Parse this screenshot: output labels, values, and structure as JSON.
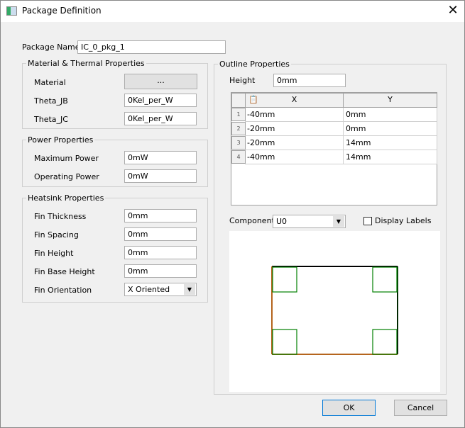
{
  "window": {
    "title": "Package Definition",
    "close_label": "✕"
  },
  "package_name": {
    "label": "Package Name",
    "value": "IC_0_pkg_1"
  },
  "material_group": {
    "title": "Material & Thermal Properties",
    "material_label": "Material",
    "material_button": "...",
    "theta_jb_label": "Theta_JB",
    "theta_jb": "0Kel_per_W",
    "theta_jc_label": "Theta_JC",
    "theta_jc": "0Kel_per_W"
  },
  "power_group": {
    "title": "Power Properties",
    "max_label": "Maximum Power",
    "max": "0mW",
    "op_label": "Operating Power",
    "op": "0mW"
  },
  "heatsink_group": {
    "title": "Heatsink Properties",
    "fin_thickness_label": "Fin Thickness",
    "fin_thickness": "0mm",
    "fin_spacing_label": "Fin Spacing",
    "fin_spacing": "0mm",
    "fin_height_label": "Fin Height",
    "fin_height": "0mm",
    "fin_base_label": "Fin Base Height",
    "fin_base": "0mm",
    "fin_orient_label": "Fin Orientation",
    "fin_orient": "X Oriented"
  },
  "outline": {
    "title": "Outline Properties",
    "height_label": "Height",
    "height": "0mm",
    "columns": [
      "X",
      "Y"
    ],
    "rows": [
      {
        "n": "1",
        "x": "-40mm",
        "y": "0mm"
      },
      {
        "n": "2",
        "x": "-20mm",
        "y": "0mm"
      },
      {
        "n": "3",
        "x": "-20mm",
        "y": "14mm"
      },
      {
        "n": "4",
        "x": "-40mm",
        "y": "14mm"
      }
    ],
    "component_label": "Component",
    "component": "U0",
    "display_labels": "Display Labels",
    "display_labels_checked": false
  },
  "preview_colors": {
    "outline_left_bottom": "#b5651d",
    "outline_top_right": "#000000",
    "fins": "#008000"
  },
  "buttons": {
    "ok": "OK",
    "cancel": "Cancel"
  }
}
